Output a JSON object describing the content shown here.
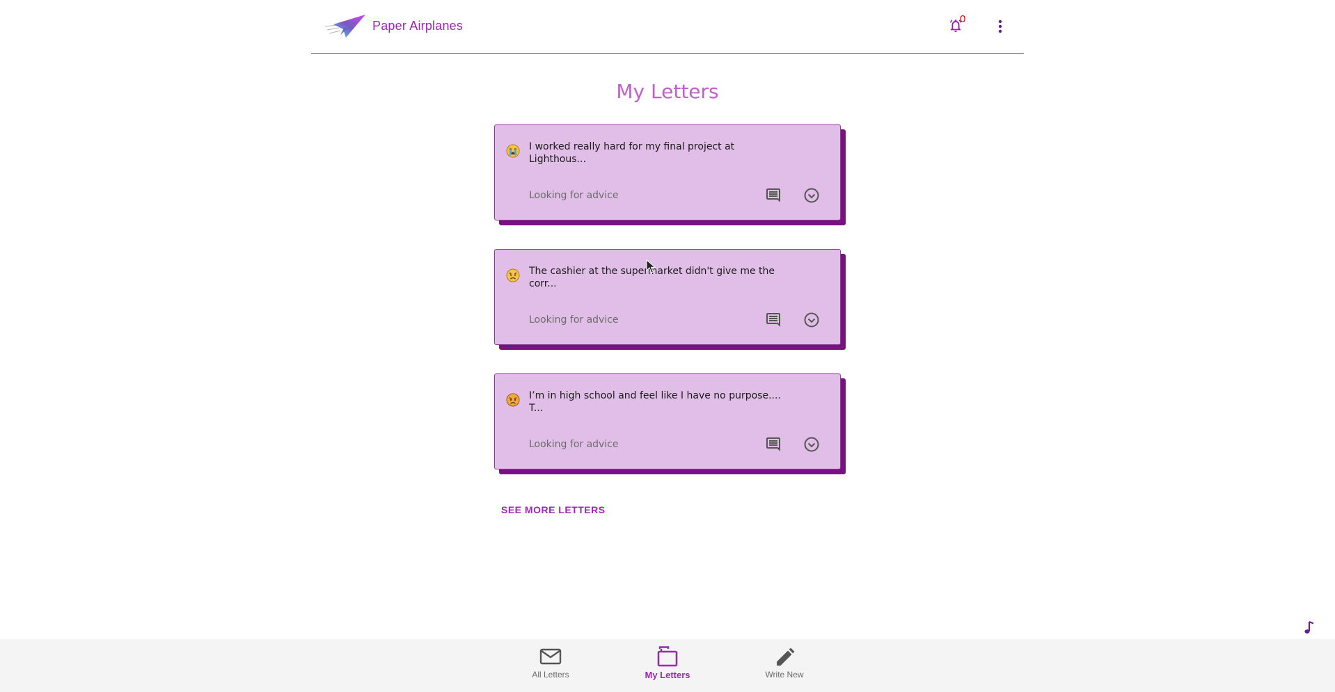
{
  "header": {
    "brand": "Paper Airplanes",
    "notification_count": "0"
  },
  "page": {
    "title": "My Letters"
  },
  "letters": [
    {
      "text": "I worked really hard for my final project at Lighthous...",
      "tag": "Looking for advice",
      "mood_icon": "crying-face-icon"
    },
    {
      "text": "The cashier at the supermarket didn't give me the corr...",
      "tag": "Looking for advice",
      "mood_icon": "sad-face-icon"
    },
    {
      "text": "I’m in high school and feel like I have no purpose.... T...",
      "tag": "Looking for advice",
      "mood_icon": "angry-face-icon"
    }
  ],
  "see_more": "SEE MORE LETTERS",
  "bottom_nav": {
    "items": [
      {
        "label": "All Letters",
        "icon": "envelope-icon",
        "active": false
      },
      {
        "label": "My Letters",
        "icon": "folder-icon",
        "active": true
      },
      {
        "label": "Write New",
        "icon": "pencil-icon",
        "active": false
      }
    ]
  },
  "colors": {
    "accent": "#9c27b0",
    "card_bg": "#e1bee7",
    "card_shadow": "#7b1083",
    "title": "#c060c8",
    "notification": "#e00000"
  }
}
